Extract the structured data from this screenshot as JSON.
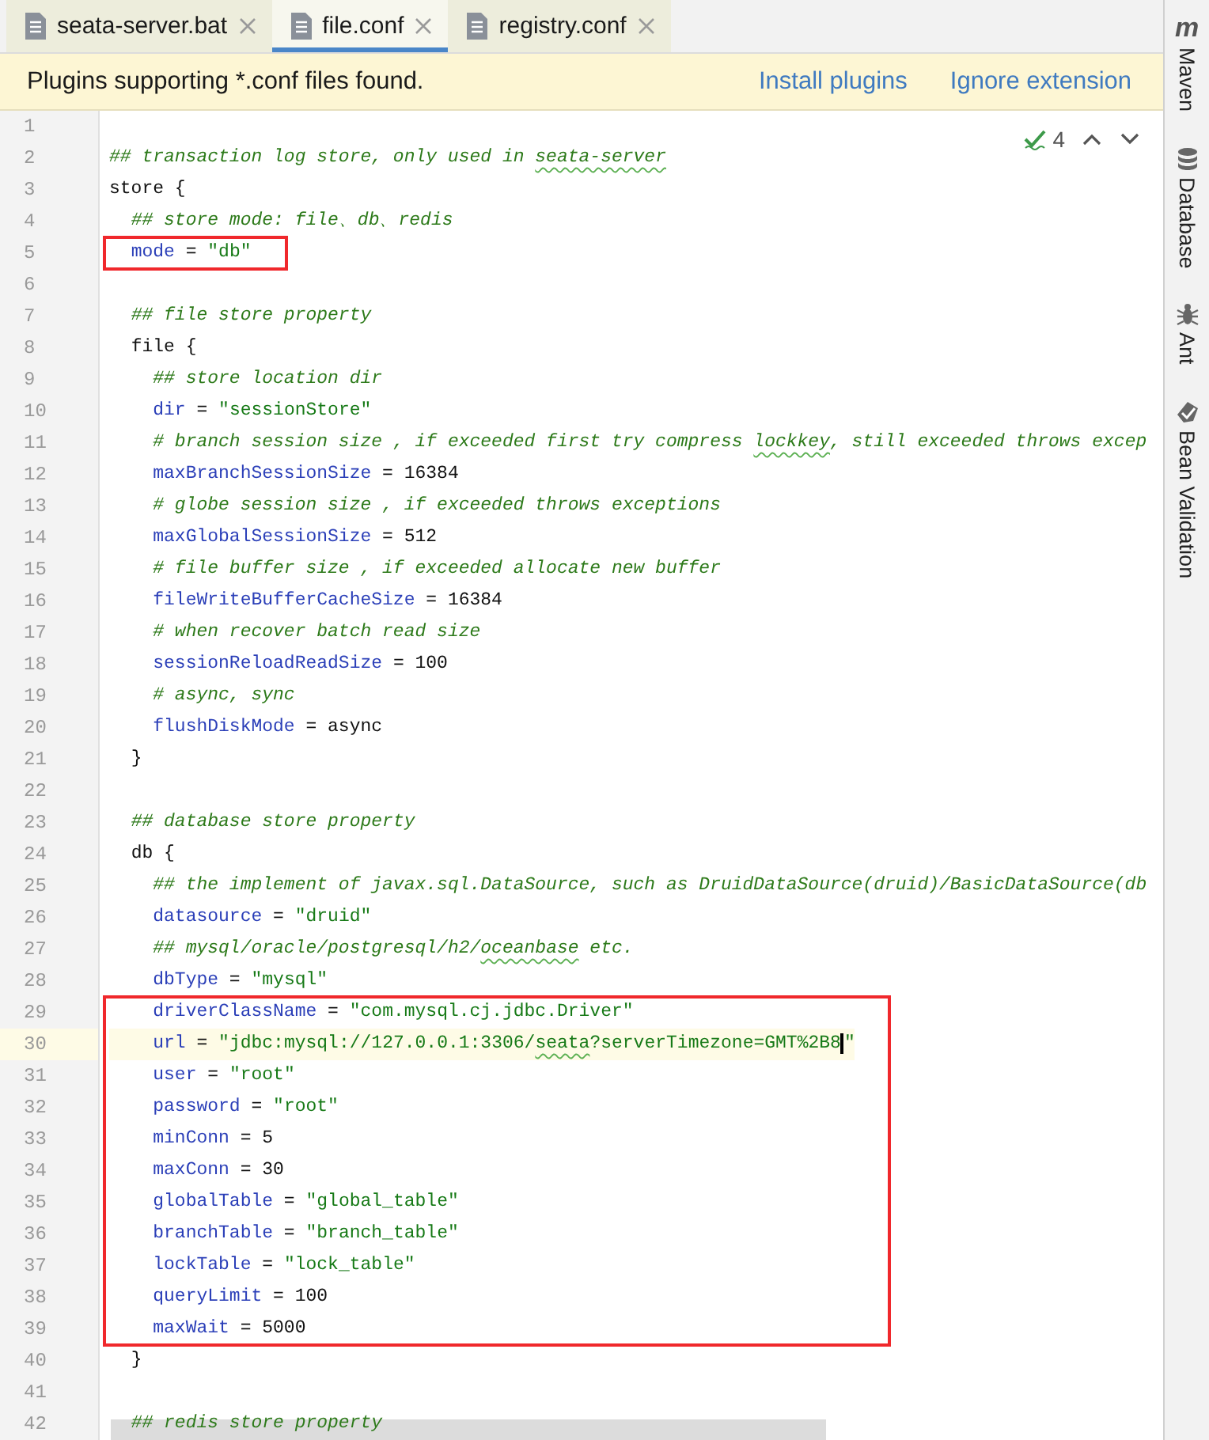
{
  "tabs": [
    {
      "label": "seata-server.bat",
      "selected": false
    },
    {
      "label": "file.conf",
      "selected": true
    },
    {
      "label": "registry.conf",
      "selected": false
    }
  ],
  "banner": {
    "message": "Plugins supporting *.conf files found.",
    "actions": [
      "Install plugins",
      "Ignore extension"
    ]
  },
  "inspections": {
    "count": "4"
  },
  "editor": {
    "lines": [
      {
        "kind": "line",
        "number": "1"
      },
      {
        "kind": "line",
        "number": "2",
        "tokens": [
          {
            "kind": "comment",
            "text": "## transaction log store, only used in "
          },
          {
            "kind": "comment",
            "text": "seata-server",
            "typo": true
          }
        ]
      },
      {
        "kind": "line",
        "number": "3",
        "tokens": [
          {
            "kind": "plain",
            "text": "store {"
          }
        ],
        "children": [
          {
            "kind": "line",
            "number": "4",
            "tokens": [
              {
                "kind": "comment",
                "text": "## store mode: file、db、redis"
              }
            ]
          },
          {
            "kind": "highlight",
            "lines": [
              {
                "kind": "line",
                "number": "5",
                "tokens": [
                  {
                    "kind": "key",
                    "text": "mode"
                  },
                  {
                    "kind": "plain",
                    "text": " = "
                  },
                  {
                    "kind": "string",
                    "text": "\"db\""
                  }
                ]
              }
            ]
          },
          {
            "kind": "line",
            "number": "6"
          },
          {
            "kind": "line",
            "number": "7",
            "tokens": [
              {
                "kind": "comment",
                "text": "## file store property"
              }
            ]
          },
          {
            "kind": "line",
            "number": "8",
            "tokens": [
              {
                "kind": "plain",
                "text": "file {"
              }
            ],
            "children": [
              {
                "kind": "line",
                "number": "9",
                "tokens": [
                  {
                    "kind": "comment",
                    "text": "## store location dir"
                  }
                ]
              },
              {
                "kind": "line",
                "number": "10",
                "tokens": [
                  {
                    "kind": "key",
                    "text": "dir"
                  },
                  {
                    "kind": "plain",
                    "text": " = "
                  },
                  {
                    "kind": "string",
                    "text": "\"sessionStore\""
                  }
                ]
              },
              {
                "kind": "line",
                "number": "11",
                "tokens": [
                  {
                    "kind": "comment",
                    "text": "# branch session size , if exceeded first try compress "
                  },
                  {
                    "kind": "comment",
                    "text": "lockkey",
                    "typo": true
                  },
                  {
                    "kind": "comment",
                    "text": ", still exceeded throws excep"
                  }
                ]
              },
              {
                "kind": "line",
                "number": "12",
                "tokens": [
                  {
                    "kind": "key",
                    "text": "maxBranchSessionSize"
                  },
                  {
                    "kind": "plain",
                    "text": " = 16384"
                  }
                ]
              },
              {
                "kind": "line",
                "number": "13",
                "tokens": [
                  {
                    "kind": "comment",
                    "text": "# globe session size , if exceeded throws exceptions"
                  }
                ]
              },
              {
                "kind": "line",
                "number": "14",
                "tokens": [
                  {
                    "kind": "key",
                    "text": "maxGlobalSessionSize"
                  },
                  {
                    "kind": "plain",
                    "text": " = 512"
                  }
                ]
              },
              {
                "kind": "line",
                "number": "15",
                "tokens": [
                  {
                    "kind": "comment",
                    "text": "# file buffer size , if exceeded allocate new buffer"
                  }
                ]
              },
              {
                "kind": "line",
                "number": "16",
                "tokens": [
                  {
                    "kind": "key",
                    "text": "fileWriteBufferCacheSize"
                  },
                  {
                    "kind": "plain",
                    "text": " = 16384"
                  }
                ]
              },
              {
                "kind": "line",
                "number": "17",
                "tokens": [
                  {
                    "kind": "comment",
                    "text": "# when recover batch read size"
                  }
                ]
              },
              {
                "kind": "line",
                "number": "18",
                "tokens": [
                  {
                    "kind": "key",
                    "text": "sessionReloadReadSize"
                  },
                  {
                    "kind": "plain",
                    "text": " = 100"
                  }
                ]
              },
              {
                "kind": "line",
                "number": "19",
                "tokens": [
                  {
                    "kind": "comment",
                    "text": "# async, sync"
                  }
                ]
              },
              {
                "kind": "line",
                "number": "20",
                "tokens": [
                  {
                    "kind": "key",
                    "text": "flushDiskMode"
                  },
                  {
                    "kind": "plain",
                    "text": " = async"
                  }
                ]
              }
            ]
          },
          {
            "kind": "line",
            "number": "21",
            "tokens": [
              {
                "kind": "plain",
                "text": "}"
              }
            ]
          },
          {
            "kind": "line",
            "number": "22"
          },
          {
            "kind": "line",
            "number": "23",
            "tokens": [
              {
                "kind": "comment",
                "text": "## database store property"
              }
            ]
          },
          {
            "kind": "line",
            "number": "24",
            "tokens": [
              {
                "kind": "plain",
                "text": "db {"
              }
            ],
            "children": [
              {
                "kind": "line",
                "number": "25",
                "tokens": [
                  {
                    "kind": "comment",
                    "text": "## the implement of javax.sql.DataSource, such as DruidDataSource(druid)/BasicDataSource(db"
                  }
                ]
              },
              {
                "kind": "line",
                "number": "26",
                "tokens": [
                  {
                    "kind": "key",
                    "text": "datasource"
                  },
                  {
                    "kind": "plain",
                    "text": " = "
                  },
                  {
                    "kind": "string",
                    "text": "\"druid\""
                  }
                ]
              },
              {
                "kind": "line",
                "number": "27",
                "tokens": [
                  {
                    "kind": "comment",
                    "text": "## mysql/oracle/postgresql/h2/"
                  },
                  {
                    "kind": "comment",
                    "text": "oceanbase",
                    "typo": true
                  },
                  {
                    "kind": "comment",
                    "text": " etc."
                  }
                ]
              },
              {
                "kind": "line",
                "number": "28",
                "tokens": [
                  {
                    "kind": "key",
                    "text": "dbType"
                  },
                  {
                    "kind": "plain",
                    "text": " = "
                  },
                  {
                    "kind": "string",
                    "text": "\"mysql\""
                  }
                ]
              },
              {
                "kind": "highlight",
                "lines": [
                  {
                    "kind": "line",
                    "number": "29",
                    "tokens": [
                      {
                        "kind": "key",
                        "text": "driverClassName"
                      },
                      {
                        "kind": "plain",
                        "text": " = "
                      },
                      {
                        "kind": "string",
                        "text": "\"com.mysql.cj.jdbc.Driver\""
                      }
                    ]
                  },
                  {
                    "kind": "line",
                    "number": "30",
                    "current": true,
                    "tokens": [
                      {
                        "kind": "key",
                        "text": "url"
                      },
                      {
                        "kind": "plain",
                        "text": " = "
                      },
                      {
                        "kind": "string",
                        "text": "\"jdbc:mysql://127.0.0.1:3306/"
                      },
                      {
                        "kind": "string",
                        "text": "seata",
                        "typo": true
                      },
                      {
                        "kind": "string",
                        "text": "?serverTimezone=GMT%2B8",
                        "caret": true
                      },
                      {
                        "kind": "string",
                        "text": "\""
                      }
                    ]
                  },
                  {
                    "kind": "line",
                    "number": "31",
                    "tokens": [
                      {
                        "kind": "key",
                        "text": "user"
                      },
                      {
                        "kind": "plain",
                        "text": " = "
                      },
                      {
                        "kind": "string",
                        "text": "\"root\""
                      }
                    ]
                  },
                  {
                    "kind": "line",
                    "number": "32",
                    "tokens": [
                      {
                        "kind": "key",
                        "text": "password"
                      },
                      {
                        "kind": "plain",
                        "text": " = "
                      },
                      {
                        "kind": "string",
                        "text": "\"root\""
                      }
                    ]
                  },
                  {
                    "kind": "line",
                    "number": "33",
                    "tokens": [
                      {
                        "kind": "key",
                        "text": "minConn"
                      },
                      {
                        "kind": "plain",
                        "text": " = 5"
                      }
                    ]
                  },
                  {
                    "kind": "line",
                    "number": "34",
                    "tokens": [
                      {
                        "kind": "key",
                        "text": "maxConn"
                      },
                      {
                        "kind": "plain",
                        "text": " = 30"
                      }
                    ]
                  },
                  {
                    "kind": "line",
                    "number": "35",
                    "tokens": [
                      {
                        "kind": "key",
                        "text": "globalTable"
                      },
                      {
                        "kind": "plain",
                        "text": " = "
                      },
                      {
                        "kind": "string",
                        "text": "\"global_table\""
                      }
                    ]
                  },
                  {
                    "kind": "line",
                    "number": "36",
                    "tokens": [
                      {
                        "kind": "key",
                        "text": "branchTable"
                      },
                      {
                        "kind": "plain",
                        "text": " = "
                      },
                      {
                        "kind": "string",
                        "text": "\"branch_table\""
                      }
                    ]
                  },
                  {
                    "kind": "line",
                    "number": "37",
                    "tokens": [
                      {
                        "kind": "key",
                        "text": "lockTable"
                      },
                      {
                        "kind": "plain",
                        "text": " = "
                      },
                      {
                        "kind": "string",
                        "text": "\"lock_table\""
                      }
                    ]
                  },
                  {
                    "kind": "line",
                    "number": "38",
                    "tokens": [
                      {
                        "kind": "key",
                        "text": "queryLimit"
                      },
                      {
                        "kind": "plain",
                        "text": " = 100"
                      }
                    ]
                  },
                  {
                    "kind": "line",
                    "number": "39",
                    "tokens": [
                      {
                        "kind": "key",
                        "text": "maxWait"
                      },
                      {
                        "kind": "plain",
                        "text": " = 5000"
                      }
                    ]
                  }
                ]
              }
            ]
          },
          {
            "kind": "line",
            "number": "40",
            "tokens": [
              {
                "kind": "plain",
                "text": "}"
              }
            ]
          },
          {
            "kind": "line",
            "number": "41"
          },
          {
            "kind": "line",
            "number": "42",
            "tokens": [
              {
                "kind": "comment",
                "text": "## redis store property"
              }
            ]
          }
        ]
      }
    ]
  },
  "tool_windows": [
    {
      "kind": "letter",
      "glyph": "m",
      "label": "Maven"
    },
    {
      "kind": "database",
      "label": "Database"
    },
    {
      "kind": "bug",
      "label": "Ant"
    },
    {
      "kind": "bean",
      "label": "Bean Validation"
    }
  ]
}
